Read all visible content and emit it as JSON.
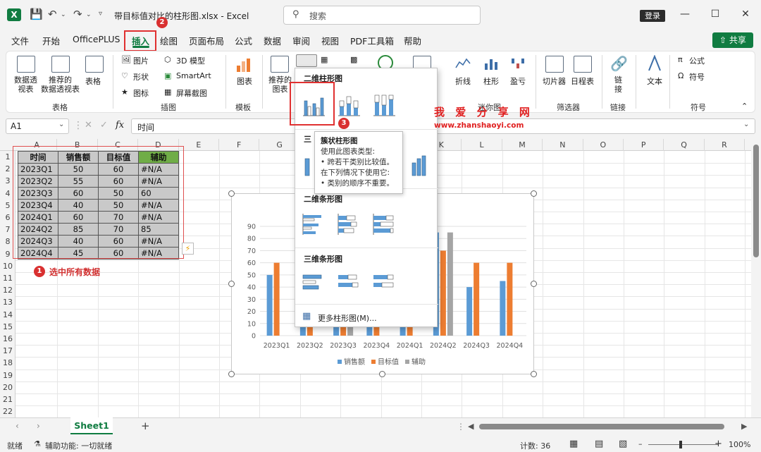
{
  "titlebar": {
    "app_letter": "X",
    "doc_title": "带目标值对比的柱形图.xlsx  -  Excel",
    "search_placeholder": "搜索",
    "login": "登录",
    "min": "—",
    "max": "☐",
    "close": "✕"
  },
  "menu": {
    "items": [
      "文件",
      "开始",
      "OfficePLUS",
      "插入",
      "绘图",
      "页面布局",
      "公式",
      "数据",
      "审阅",
      "视图",
      "PDF工具箱",
      "帮助"
    ],
    "share": "共享"
  },
  "ribbon": {
    "pivot": "数据透\n视表",
    "rec_pivot": "推荐的\n数据透视表",
    "table": "表格",
    "group_table": "表格",
    "picture": "图片",
    "shapes": "形状",
    "icons": "图标",
    "model3d": "3D 模型",
    "smartart": "SmartArt",
    "screenshot": "屏幕截图",
    "group_illustrations": "插图",
    "charts_btn": "图表",
    "group_template": "模板",
    "rec_charts": "推荐的\n图表",
    "line": "折线",
    "column": "柱形",
    "winloss": "盈亏",
    "group_sparkline": "迷你图",
    "slicer": "切片器",
    "timeline": "日程表",
    "group_filter": "筛选器",
    "link": "链\n接",
    "group_link": "链接",
    "text": "文本",
    "equation": "公式",
    "symbol": "符号",
    "group_symbol": "符号"
  },
  "formula": {
    "cell": "A1",
    "fx": "fx",
    "value": "时间"
  },
  "grid": {
    "columns": [
      "A",
      "B",
      "C",
      "D",
      "E",
      "F",
      "G",
      "H",
      "I",
      "J",
      "K",
      "L",
      "M",
      "N",
      "O",
      "P",
      "Q",
      "R"
    ],
    "rows": [
      "1",
      "2",
      "3",
      "4",
      "5",
      "6",
      "7",
      "8",
      "9",
      "10",
      "11",
      "12",
      "13",
      "14",
      "15",
      "16",
      "17",
      "18",
      "19",
      "20",
      "21",
      "22"
    ],
    "table": {
      "headers": [
        "时间",
        "销售额",
        "目标值",
        "辅助"
      ],
      "rows": [
        [
          "2023Q1",
          "50",
          "60",
          "#N/A"
        ],
        [
          "2023Q2",
          "55",
          "60",
          "#N/A"
        ],
        [
          "2023Q3",
          "60",
          "50",
          "60"
        ],
        [
          "2023Q4",
          "40",
          "50",
          "#N/A"
        ],
        [
          "2024Q1",
          "60",
          "70",
          "#N/A"
        ],
        [
          "2024Q2",
          "85",
          "70",
          "85"
        ],
        [
          "2024Q3",
          "40",
          "60",
          "#N/A"
        ],
        [
          "2024Q4",
          "45",
          "60",
          "#N/A"
        ]
      ]
    }
  },
  "annotations": {
    "step1": "1",
    "step1_text": "选中所有数据",
    "step2": "2",
    "step3": "3",
    "watermark_cn": "我 爱 分 享 网",
    "watermark_url": "www.zhanshaoyi.com"
  },
  "dropdown": {
    "h2d_column": "二维柱形图",
    "h3d_column": "三",
    "h2d_bar": "二维条形图",
    "h3d_bar": "三维条形图",
    "more": "更多柱形图(M)..."
  },
  "tooltip": {
    "title": "簇状柱形图",
    "line1": "使用此图表类型:",
    "line2": "• 跨若干类别比较值。",
    "line3": "在下列情况下使用它:",
    "line4": "• 类别的顺序不重要。"
  },
  "chart_data": {
    "type": "bar",
    "categories": [
      "2023Q1",
      "2023Q2",
      "2023Q3",
      "2023Q4",
      "2024Q1",
      "2024Q2",
      "2024Q3",
      "2024Q4"
    ],
    "series": [
      {
        "name": "销售额",
        "color": "#5b9bd5",
        "values": [
          50,
          55,
          60,
          40,
          60,
          85,
          40,
          45
        ]
      },
      {
        "name": "目标值",
        "color": "#ed7d31",
        "values": [
          60,
          60,
          50,
          50,
          70,
          70,
          60,
          60
        ]
      },
      {
        "name": "辅助",
        "color": "#a5a5a5",
        "values": [
          null,
          null,
          60,
          null,
          null,
          85,
          null,
          null
        ]
      }
    ],
    "yticks": [
      "0",
      "10",
      "20",
      "30",
      "40",
      "50",
      "60",
      "70",
      "80",
      "90"
    ],
    "ylim": [
      0,
      90
    ],
    "legend": "bottom"
  },
  "sheets": {
    "tab": "Sheet1",
    "add": "+"
  },
  "status": {
    "ready": "就绪",
    "accessibility": "辅助功能: 一切就绪",
    "count": "计数: 36",
    "zoom": "100%"
  }
}
